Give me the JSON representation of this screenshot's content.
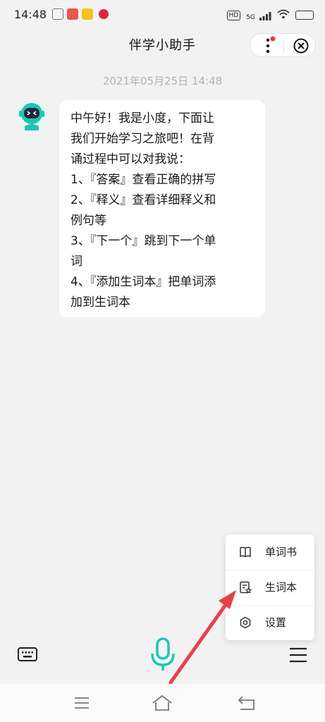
{
  "status_bar": {
    "time": "14:48",
    "hd_badge": "HD",
    "network": "5G",
    "battery_label": "",
    "app_icons": [
      "notification-icon",
      "app-icon",
      "app-icon",
      "app-icon"
    ]
  },
  "header": {
    "title": "伴学小助手",
    "more_icon": "more-vertical-icon",
    "close_icon": "close-circle-icon",
    "accent_dot_color": "#e53935"
  },
  "chat": {
    "timestamp": "2021年05月25日 14:48",
    "messages": [
      {
        "sender_avatar": "robot-avatar-icon",
        "lines": [
          "中午好！我是小度，下面让",
          "我们开始学习之旅吧！在背",
          "诵过程中可以对我说：",
          "1、『答案』查看正确的拼写",
          "2、『释义』查看详细释义和",
          "例句等",
          "3、『下一个』跳到下一个单",
          "词",
          "4、『添加生词本』把单词添",
          "加到生词本"
        ]
      }
    ]
  },
  "popup_menu": {
    "items": [
      {
        "label": "单词书",
        "icon": "book-icon"
      },
      {
        "label": "生词本",
        "icon": "vocab-notebook-icon"
      },
      {
        "label": "设置",
        "icon": "settings-icon"
      }
    ]
  },
  "toolbar": {
    "keyboard_icon": "keyboard-icon",
    "mic_icon": "microphone-icon",
    "menu_icon": "hamburger-menu-icon",
    "mic_color": "#1fc6b4"
  },
  "annotation": {
    "arrow_color": "#e8404a"
  },
  "nav_bar": {
    "items": [
      "menu-icon",
      "home-icon",
      "back-icon"
    ]
  }
}
